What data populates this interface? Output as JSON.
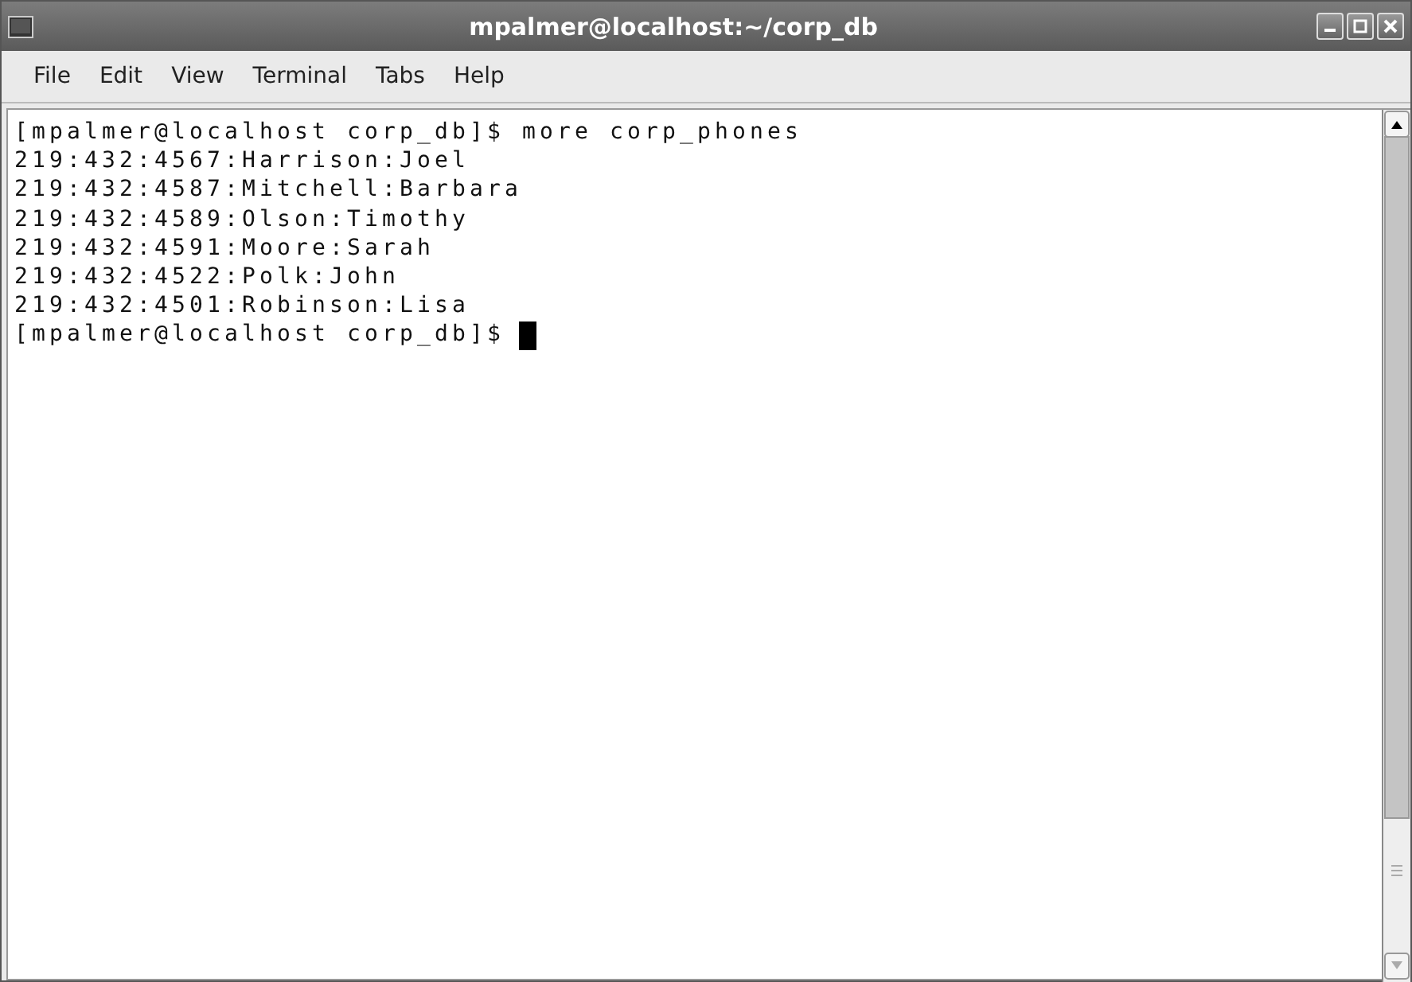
{
  "window": {
    "title": "mpalmer@localhost:~/corp_db"
  },
  "menu": [
    "File",
    "Edit",
    "View",
    "Terminal",
    "Tabs",
    "Help"
  ],
  "terminal": {
    "lines": [
      "[mpalmer@localhost corp_db]$ more corp_phones",
      "219:432:4567:Harrison:Joel",
      "219:432:4587:Mitchell:Barbara",
      "219:432:4589:Olson:Timothy",
      "219:432:4591:Moore:Sarah",
      "219:432:4522:Polk:John",
      "219:432:4501:Robinson:Lisa"
    ],
    "prompt": "[mpalmer@localhost corp_db]$"
  }
}
